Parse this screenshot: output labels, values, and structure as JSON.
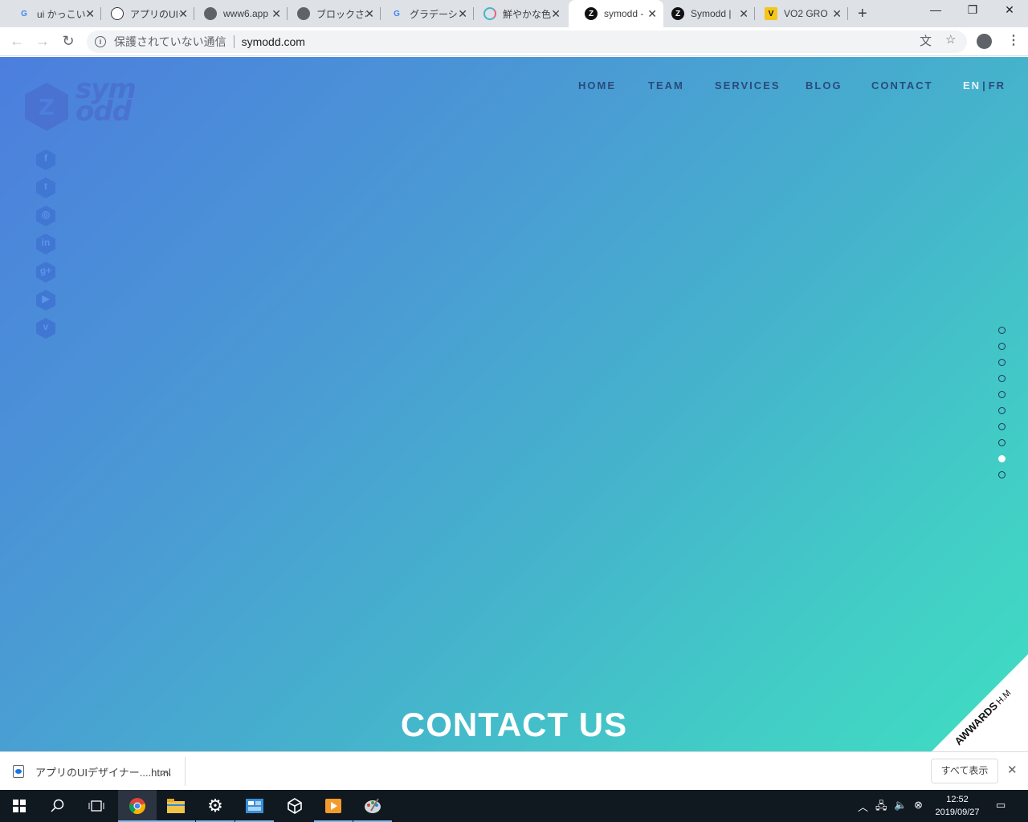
{
  "browser": {
    "tabs": [
      {
        "title": "ui かっこいい",
        "favicon": "google-icon",
        "active": false
      },
      {
        "title": "アプリのUIデ",
        "favicon": "panda-icon",
        "active": false
      },
      {
        "title": "www6.app",
        "favicon": "globe-icon",
        "active": false
      },
      {
        "title": "ブロックされ",
        "favicon": "globe-icon",
        "active": false
      },
      {
        "title": "グラデーショ",
        "favicon": "google-icon",
        "active": false
      },
      {
        "title": "鮮やかな色",
        "favicon": "q-icon",
        "active": false
      },
      {
        "title": "symodd -",
        "favicon": "symodd-icon",
        "active": true
      },
      {
        "title": "Symodd |",
        "favicon": "symodd-icon",
        "active": false
      },
      {
        "title": "VO2 GRO",
        "favicon": "v-icon",
        "active": false
      }
    ],
    "tab_close_glyph": "✕",
    "new_tab_glyph": "+",
    "window_controls": {
      "minimize": "—",
      "restore": "❐",
      "close": "✕"
    },
    "address": {
      "security_label": "保護されていない通信",
      "url": "symodd.com"
    }
  },
  "site": {
    "logo_text": "sym odd",
    "social_icons": [
      {
        "name": "facebook-icon",
        "glyph": "f"
      },
      {
        "name": "twitter-icon",
        "glyph": "t"
      },
      {
        "name": "instagram-icon",
        "glyph": "◎"
      },
      {
        "name": "linkedin-icon",
        "glyph": "in"
      },
      {
        "name": "googleplus-icon",
        "glyph": "g+"
      },
      {
        "name": "youtube-icon",
        "glyph": "▶"
      },
      {
        "name": "vimeo-icon",
        "glyph": "v"
      }
    ],
    "nav": {
      "home": "HOME",
      "team": "TEAM",
      "services": "SERVICES",
      "blog": "BLOG",
      "contact": "CONTACT"
    },
    "lang": {
      "en": "EN",
      "separator": "|",
      "fr": "FR",
      "active": "EN"
    },
    "section_dots": {
      "count": 10,
      "active_index": 8
    },
    "section_heading": "CONTACT US",
    "awwards_badge": {
      "brand": "AWWARDS",
      "label": "H.M"
    },
    "colors": {
      "gradient_start": "#4c7ede",
      "gradient_end": "#3fddc2",
      "nav_text": "#2b4a7c",
      "heading": "#ffffff"
    }
  },
  "download_bar": {
    "filename": "アプリのUIデザイナー....html",
    "show_all": "すべて表示",
    "close_glyph": "✕"
  },
  "taskbar": {
    "time": "12:52",
    "date": "2019/09/27"
  }
}
